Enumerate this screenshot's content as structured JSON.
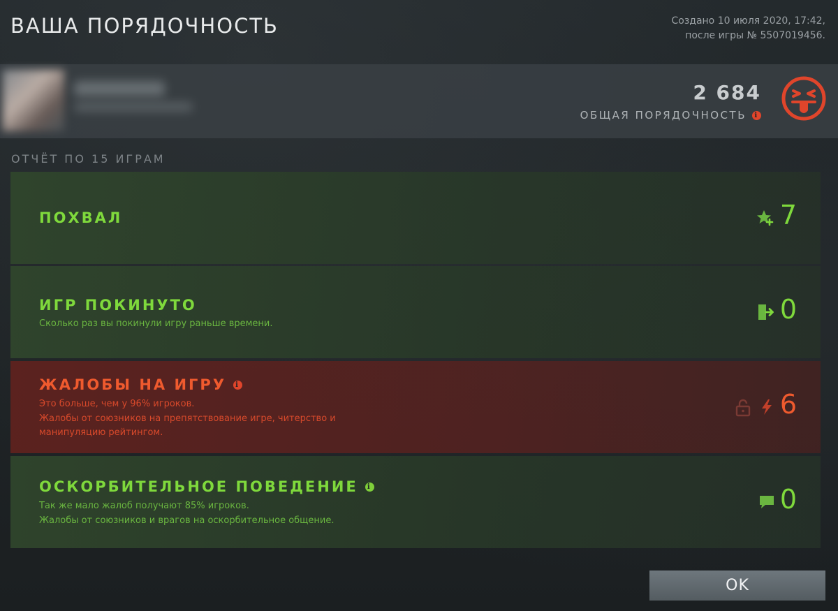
{
  "header": {
    "title": "ВАША ПОРЯДОЧНОСТЬ",
    "created_line": "Создано 10 июля 2020, 17:42,",
    "match_line": "после игры № 5507019456."
  },
  "profile": {
    "score": "2 684",
    "score_label": "ОБЩАЯ ПОРЯДОЧНОСТЬ",
    "face_icon": "angry-face-icon",
    "accent_color": "#e0452b"
  },
  "report": {
    "heading": "ОТЧЁТ ПО 15 ИГРАМ",
    "cards": [
      {
        "title": "ПОХВАЛ",
        "lines": [],
        "value": "7",
        "icon": "star-plus-icon",
        "tone": "green"
      },
      {
        "title": "ИГР ПОКИНУТО",
        "lines": [
          "Сколько раз вы покинули игру раньше времени."
        ],
        "value": "0",
        "icon": "exit-door-icon",
        "tone": "green"
      },
      {
        "title": "ЖАЛОБЫ НА ИГРУ",
        "lines": [
          "Это больше, чем у 96% игроков.",
          "Жалобы от союзников на препятствование игре, читерство и",
          "манипуляцию рейтингом."
        ],
        "value": "6",
        "icon": "lightning-icon",
        "secondary_icon": "lock-icon",
        "tone": "red"
      },
      {
        "title": "ОСКОРБИТЕЛЬНОЕ ПОВЕДЕНИЕ",
        "lines": [
          "Так же мало жалоб получают 85% игроков.",
          "Жалобы от союзников и врагов на оскорбительное общение."
        ],
        "value": "0",
        "icon": "chat-bubble-icon",
        "tone": "green"
      }
    ]
  },
  "actions": {
    "ok_label": "OK"
  },
  "colors": {
    "positive": "#7fd93c",
    "negative": "#ef5a2e"
  }
}
